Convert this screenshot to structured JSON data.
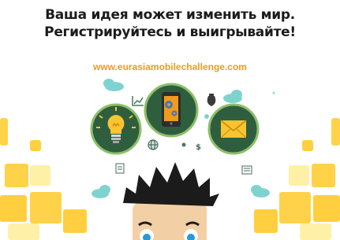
{
  "headline": {
    "line1": "Ваша идея может изменить мир.",
    "line2": "Регистрируйтесь и выигрывайте!"
  },
  "url": "www.eurasiamobilechallenge.com",
  "colors": {
    "circle_dark": "#2f5e3f",
    "circle_border": "#8ebf6a",
    "accent_orange": "#f29a1b",
    "yellow_square": "#ffd24a",
    "light_yellow": "#fff0a8",
    "cloud": "#7fd3cf",
    "hair": "#1b1b1b",
    "skin": "#f3cfa6"
  },
  "icons": [
    "lightbulb-icon",
    "phone-gear-icon",
    "envelope-icon",
    "cloud-icon",
    "chart-icon",
    "money-bag-icon",
    "globe-icon",
    "document-icon",
    "dollar-icon"
  ]
}
